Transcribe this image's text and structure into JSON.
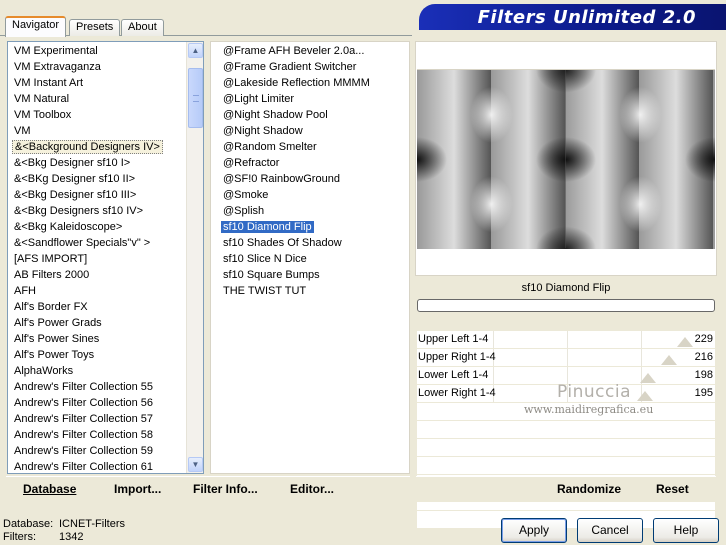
{
  "header": {
    "title": "Filters Unlimited 2.0"
  },
  "tabs": [
    {
      "label": "Navigator",
      "active": true
    },
    {
      "label": "Presets",
      "active": false
    },
    {
      "label": "About",
      "active": false
    }
  ],
  "categories": [
    "VM Experimental",
    "VM Extravaganza",
    "VM Instant Art",
    "VM Natural",
    "VM Toolbox",
    "VM",
    "&<Background Designers IV>",
    "&<Bkg Designer sf10 I>",
    "&<BKg Designer sf10 II>",
    "&<Bkg Designer sf10 III>",
    "&<Bkg Designers sf10 IV>",
    "&<Bkg Kaleidoscope>",
    "&<Sandflower Specials\"v\" >",
    "[AFS IMPORT]",
    "AB Filters 2000",
    "AFH",
    "Alf's Border FX",
    "Alf's Power Grads",
    "Alf's Power Sines",
    "Alf's Power Toys",
    "AlphaWorks",
    "Andrew's Filter Collection 55",
    "Andrew's Filter Collection 56",
    "Andrew's Filter Collection 57",
    "Andrew's Filter Collection 58",
    "Andrew's Filter Collection 59",
    "Andrew's Filter Collection 61"
  ],
  "categories_selected_index": 6,
  "filters": [
    "@Frame AFH Beveler 2.0a...",
    "@Frame Gradient Switcher",
    "@Lakeside Reflection MMMM",
    "@Light Limiter",
    "@Night Shadow Pool",
    "@Night Shadow",
    "@Random Smelter",
    "@Refractor",
    "@SF!0 RainbowGround",
    "@Smoke",
    "@Splish",
    "sf10 Diamond Flip",
    "sf10 Shades Of Shadow",
    "sf10 Slice N Dice",
    "sf10 Square Bumps",
    "THE TWIST TUT"
  ],
  "filters_selected_index": 11,
  "preview": {
    "filter_name": "sf10 Diamond Flip"
  },
  "params": [
    {
      "label": "Upper Left 1-4",
      "value": "229",
      "level": 229
    },
    {
      "label": "Upper Right 1-4",
      "value": "216",
      "level": 216
    },
    {
      "label": "Lower Left 1-4",
      "value": "198",
      "level": 198
    },
    {
      "label": "Lower Right 1-4",
      "value": "195",
      "level": 195
    }
  ],
  "watermark": {
    "name": "Pinuccia",
    "url": "www.maidiregrafica.eu"
  },
  "toolbar": {
    "database": "Database",
    "import": "Import...",
    "filter_info": "Filter Info...",
    "editor": "Editor...",
    "randomize": "Randomize",
    "reset": "Reset"
  },
  "info": {
    "database_label": "Database:",
    "database_value": "ICNET-Filters",
    "filters_label": "Filters:",
    "filters_value": "1342"
  },
  "buttons": {
    "apply": "Apply",
    "cancel": "Cancel",
    "help": "Help"
  },
  "icons": {
    "scroll_up": "chevron-up-icon",
    "scroll_down": "chevron-down-icon"
  }
}
